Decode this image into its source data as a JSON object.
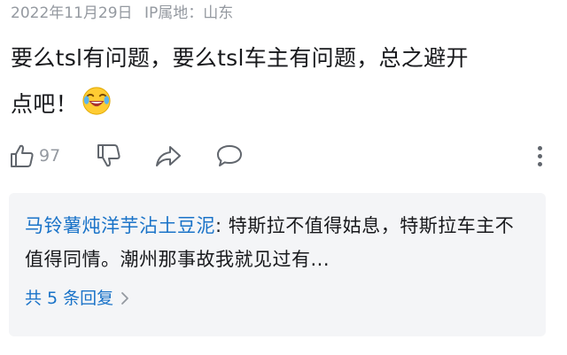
{
  "comment": {
    "date": "2022年11月29日",
    "ip_location": "IP属地：山东",
    "text_line1": "要么tsl有问题，要么tsl车主有问题，总之避开",
    "text_line2": "点吧！",
    "emoji": "laughing-crying-emoji"
  },
  "actions": {
    "like_count": "97",
    "icons": [
      "thumbs-up-icon",
      "thumbs-down-icon",
      "share-icon",
      "comment-icon",
      "more-icon"
    ]
  },
  "reply": {
    "author": "马铃薯炖洋芋沾土豆泥",
    "separator": ": ",
    "text": "特斯拉不值得姑息，特斯拉车主不值得同情。潮州那事故我就见过有...",
    "more_label": "共 5 条回复"
  },
  "colors": {
    "link": "#1a73c8",
    "meta": "#9499a0",
    "reply_bg": "#f4f5f7"
  }
}
